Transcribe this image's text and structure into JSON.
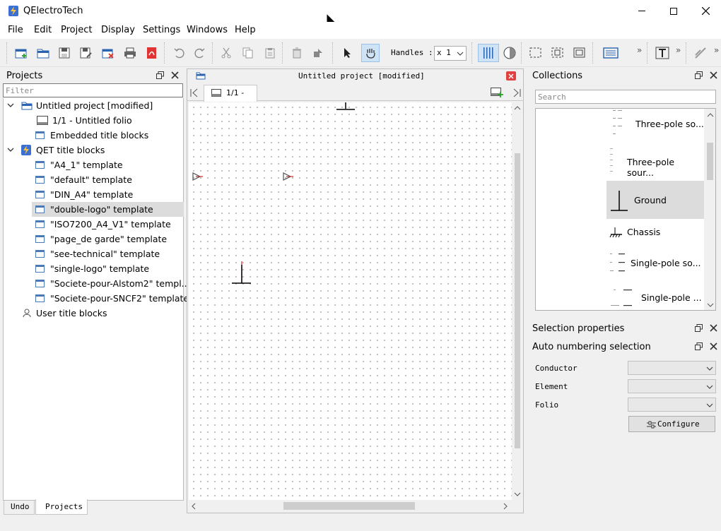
{
  "window": {
    "title": "QElectroTech"
  },
  "menu": [
    "File",
    "Edit",
    "Project",
    "Display",
    "Settings",
    "Windows",
    "Help"
  ],
  "toolbar": {
    "handles_label": "Handles :",
    "handles_value": "x 1"
  },
  "projects_panel": {
    "title": "Projects",
    "filter_placeholder": "Filter",
    "tree": [
      {
        "label": "Untitled project [modified]"
      },
      {
        "label": "1/1 - Untitled folio"
      },
      {
        "label": "Embedded title blocks"
      },
      {
        "label": "QET title blocks"
      },
      {
        "label": "\"A4_1\" template"
      },
      {
        "label": "\"default\" template"
      },
      {
        "label": "\"DIN_A4\" template"
      },
      {
        "label": "\"double-logo\" template"
      },
      {
        "label": "\"ISO7200_A4_V1\" template"
      },
      {
        "label": "\"page_de garde\" template"
      },
      {
        "label": "\"see-technical\" template"
      },
      {
        "label": "\"single-logo\" template"
      },
      {
        "label": "\"Societe-pour-Alstom2\" templ..."
      },
      {
        "label": "\"Societe-pour-SNCF2\" template"
      },
      {
        "label": "User title blocks"
      }
    ],
    "bottom_tabs": [
      "Undo",
      "Projects"
    ]
  },
  "editor": {
    "title": "Untitled project [modified]",
    "folio_tab": "1/1 -"
  },
  "collections": {
    "title": "Collections",
    "search_placeholder": "Search",
    "items": [
      {
        "label": "Three-pole so..."
      },
      {
        "label": "Three-pole sour..."
      },
      {
        "label": "Ground"
      },
      {
        "label": "Chassis"
      },
      {
        "label": "Single-pole so..."
      },
      {
        "label": "Single-pole ..."
      }
    ]
  },
  "selection_properties": {
    "title": "Selection properties"
  },
  "auto_numbering": {
    "title": "Auto numbering selection",
    "fields": [
      {
        "label": "Conductor"
      },
      {
        "label": "Element"
      },
      {
        "label": "Folio"
      }
    ],
    "configure_label": "Configure"
  },
  "colors": {
    "accent": "#3b6fd1",
    "selection": "#dcdcdc",
    "close_red": "#e04040"
  }
}
